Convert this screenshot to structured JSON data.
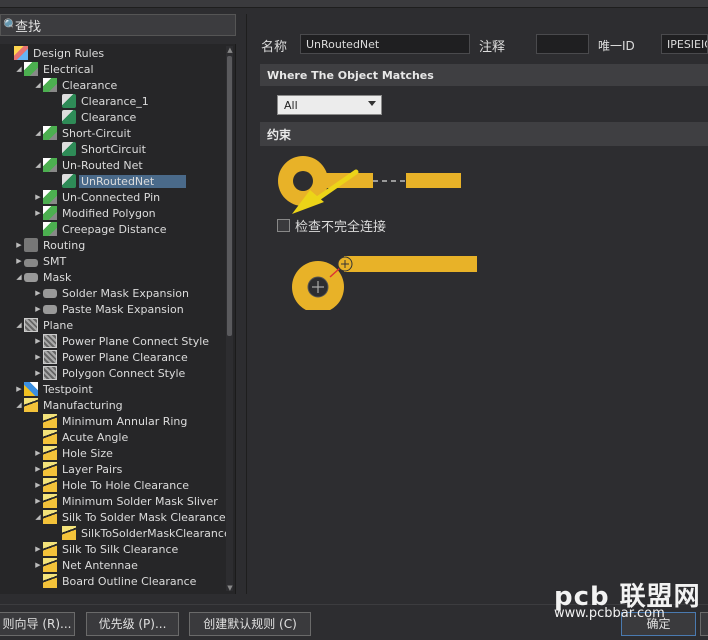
{
  "search": {
    "text": "查找"
  },
  "tree": [
    {
      "label": "Design Rules",
      "exp": "",
      "icon": "i-ds",
      "depth": 0
    },
    {
      "label": "Electrical",
      "exp": "◢",
      "icon": "i-rule",
      "depth": 1
    },
    {
      "label": "Clearance",
      "exp": "◢",
      "icon": "i-rule",
      "depth": 2
    },
    {
      "label": "Clearance_1",
      "exp": "",
      "icon": "i-rule2",
      "depth": 3
    },
    {
      "label": "Clearance",
      "exp": "",
      "icon": "i-rule2",
      "depth": 3
    },
    {
      "label": "Short-Circuit",
      "exp": "◢",
      "icon": "i-rule",
      "depth": 2
    },
    {
      "label": "ShortCircuit",
      "exp": "",
      "icon": "i-rule2",
      "depth": 3
    },
    {
      "label": "Un-Routed Net",
      "exp": "◢",
      "icon": "i-rule",
      "depth": 2
    },
    {
      "label": "UnRoutedNet",
      "exp": "",
      "icon": "i-rule2",
      "depth": 3,
      "selected": true
    },
    {
      "label": "Un-Connected Pin",
      "exp": "▶",
      "icon": "i-rule",
      "depth": 2
    },
    {
      "label": "Modified Polygon",
      "exp": "▶",
      "icon": "i-rule",
      "depth": 2
    },
    {
      "label": "Creepage Distance",
      "exp": "",
      "icon": "i-rule",
      "depth": 2
    },
    {
      "label": "Routing",
      "exp": "▶",
      "icon": "i-route",
      "depth": 1
    },
    {
      "label": "SMT",
      "exp": "▶",
      "icon": "i-smt",
      "depth": 1
    },
    {
      "label": "Mask",
      "exp": "◢",
      "icon": "i-mask",
      "depth": 1
    },
    {
      "label": "Solder Mask Expansion",
      "exp": "▶",
      "icon": "i-mask",
      "depth": 2
    },
    {
      "label": "Paste Mask Expansion",
      "exp": "▶",
      "icon": "i-mask",
      "depth": 2
    },
    {
      "label": "Plane",
      "exp": "◢",
      "icon": "i-plane",
      "depth": 1
    },
    {
      "label": "Power Plane Connect Style",
      "exp": "▶",
      "icon": "i-plane",
      "depth": 2
    },
    {
      "label": "Power Plane Clearance",
      "exp": "▶",
      "icon": "i-plane",
      "depth": 2
    },
    {
      "label": "Polygon Connect Style",
      "exp": "▶",
      "icon": "i-plane",
      "depth": 2
    },
    {
      "label": "Testpoint",
      "exp": "▶",
      "icon": "i-test",
      "depth": 1
    },
    {
      "label": "Manufacturing",
      "exp": "◢",
      "icon": "i-mfg",
      "depth": 1
    },
    {
      "label": "Minimum Annular Ring",
      "exp": "",
      "icon": "i-mfg",
      "depth": 2
    },
    {
      "label": "Acute Angle",
      "exp": "",
      "icon": "i-mfg",
      "depth": 2
    },
    {
      "label": "Hole Size",
      "exp": "▶",
      "icon": "i-mfg",
      "depth": 2
    },
    {
      "label": "Layer Pairs",
      "exp": "▶",
      "icon": "i-mfg",
      "depth": 2
    },
    {
      "label": "Hole To Hole Clearance",
      "exp": "▶",
      "icon": "i-mfg",
      "depth": 2
    },
    {
      "label": "Minimum Solder Mask Sliver",
      "exp": "▶",
      "icon": "i-mfg",
      "depth": 2
    },
    {
      "label": "Silk To Solder Mask Clearance",
      "exp": "◢",
      "icon": "i-mfg",
      "depth": 2
    },
    {
      "label": "SilkToSolderMaskClearance",
      "exp": "",
      "icon": "i-mfg",
      "depth": 3
    },
    {
      "label": "Silk To Silk Clearance",
      "exp": "▶",
      "icon": "i-mfg",
      "depth": 2
    },
    {
      "label": "Net Antennae",
      "exp": "▶",
      "icon": "i-mfg",
      "depth": 2
    },
    {
      "label": "Board Outline Clearance",
      "exp": "",
      "icon": "i-mfg",
      "depth": 2
    }
  ],
  "rule": {
    "name_label": "名称",
    "name_value": "UnRoutedNet",
    "comment_label": "注释",
    "comment_value": "",
    "id_label": "唯一ID",
    "id_value": "IPESIEIQ"
  },
  "match": {
    "header": "Where The Object Matches",
    "selected": "All"
  },
  "constraints": {
    "header": "约束",
    "check_label": "检查不完全连接",
    "checked": false
  },
  "colors": {
    "copper": "#e8b228",
    "arrow": "#ecd418",
    "select": "#4a6a8a"
  },
  "buttons": {
    "wizard": "则向导 (R)...",
    "priority": "优先级 (P)...",
    "create_default": "创建默认规则 (C)",
    "ok": "确定"
  },
  "watermark": {
    "logo": "pcb 联盟网",
    "url": "www.pcbbar.com"
  }
}
